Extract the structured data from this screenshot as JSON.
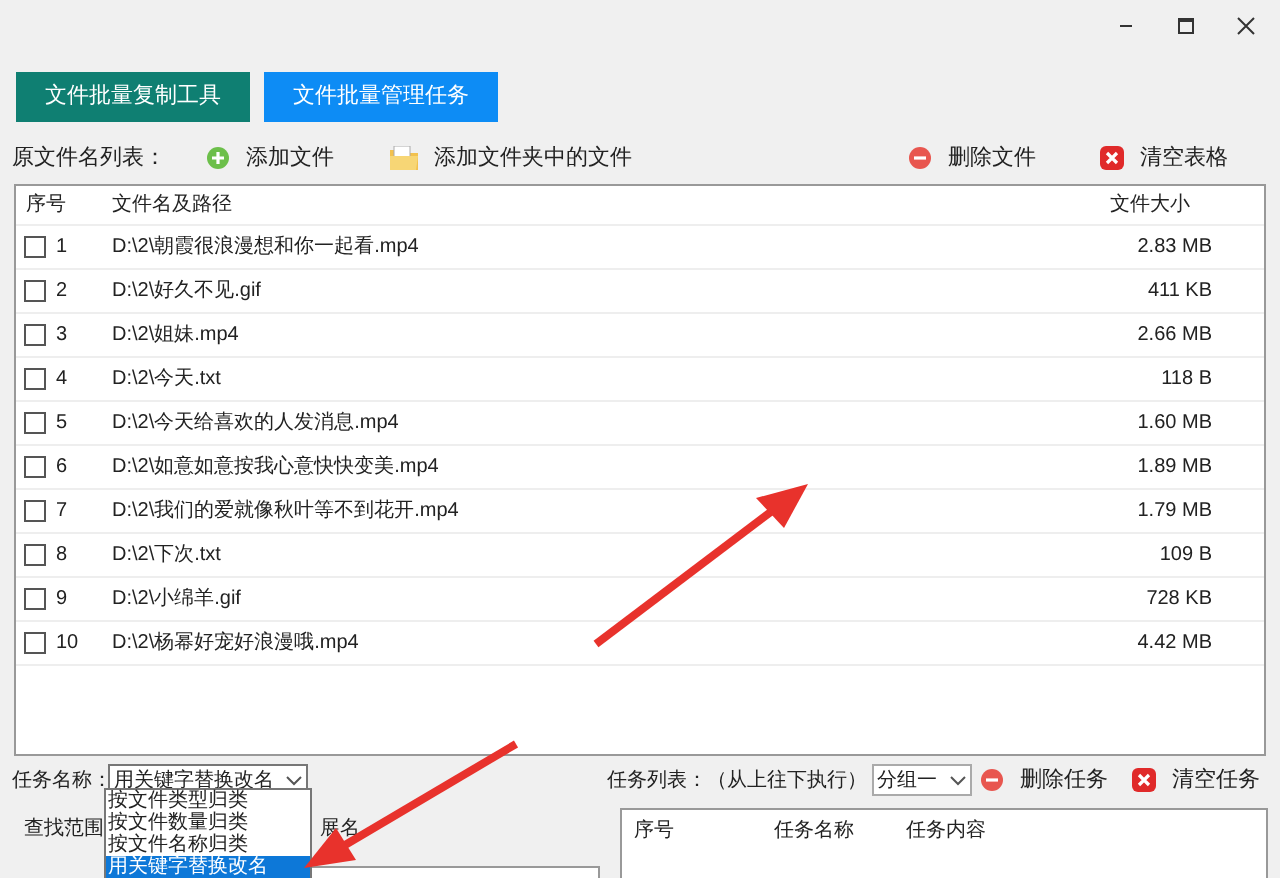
{
  "tabs": [
    {
      "label": "文件批量复制工具",
      "selected": false
    },
    {
      "label": "文件批量管理任务",
      "selected": true
    }
  ],
  "file_toolbar": {
    "label": "原文件名列表：",
    "buttons": [
      {
        "label": "添加文件",
        "kind": "add"
      },
      {
        "label": "添加文件夹中的文件",
        "kind": "folder"
      },
      {
        "label": "删除文件",
        "kind": "remove"
      },
      {
        "label": "清空表格",
        "kind": "clear"
      }
    ]
  },
  "file_table": {
    "columns": [
      "序号",
      "文件名及路径",
      "文件大小"
    ],
    "rows": [
      {
        "checked": false,
        "index": "1",
        "path": "D:\\2\\朝霞很浪漫想和你一起看.mp4",
        "size": "2.83 MB"
      },
      {
        "checked": false,
        "index": "2",
        "path": "D:\\2\\好久不见.gif",
        "size": "411 KB"
      },
      {
        "checked": false,
        "index": "3",
        "path": "D:\\2\\姐妹.mp4",
        "size": "2.66 MB"
      },
      {
        "checked": false,
        "index": "4",
        "path": "D:\\2\\今天.txt",
        "size": "118 B"
      },
      {
        "checked": false,
        "index": "5",
        "path": "D:\\2\\今天给喜欢的人发消息.mp4",
        "size": "1.60 MB"
      },
      {
        "checked": false,
        "index": "6",
        "path": "D:\\2\\如意如意按我心意快快变美.mp4",
        "size": "1.89 MB"
      },
      {
        "checked": false,
        "index": "7",
        "path": "D:\\2\\我们的爱就像秋叶等不到花开.mp4",
        "size": "1.79 MB"
      },
      {
        "checked": false,
        "index": "8",
        "path": "D:\\2\\下次.txt",
        "size": "109 B"
      },
      {
        "checked": false,
        "index": "9",
        "path": "D:\\2\\小绵羊.gif",
        "size": "728 KB"
      },
      {
        "checked": false,
        "index": "10",
        "path": "D:\\2\\杨幂好宠好浪漫哦.mp4",
        "size": "4.42 MB"
      }
    ]
  },
  "task_form": {
    "label": "任务名称：",
    "value": "用关键字替换改名",
    "options": [
      {
        "label": "按文件类型归类",
        "selected": false
      },
      {
        "label": "按文件数量归类",
        "selected": false
      },
      {
        "label": "按文件名称归类",
        "selected": false
      },
      {
        "label": "用关键字替换改名",
        "selected": true
      }
    ],
    "scope_label": "查找范围",
    "scope_tail": "展名"
  },
  "task_list": {
    "label": "任务列表：（从上往下执行）",
    "group": "分组一",
    "buttons": [
      {
        "label": "删除任务",
        "kind": "remove"
      },
      {
        "label": "清空任务",
        "kind": "clear"
      }
    ],
    "columns": [
      "序号",
      "任务名称",
      "任务内容"
    ]
  }
}
